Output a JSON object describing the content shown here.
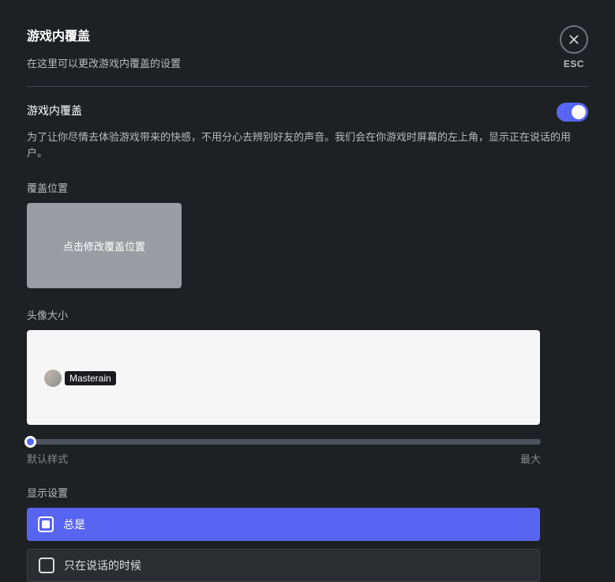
{
  "header": {
    "title": "游戏内覆盖",
    "subtitle": "在这里可以更改游戏内覆盖的设置",
    "esc_label": "ESC"
  },
  "overlay": {
    "section_title": "游戏内覆盖",
    "description": "为了让你尽情去体验游戏带来的快感，不用分心去辨别好友的声音。我们会在你游戏时屏幕的左上角，显示正在说话的用户。",
    "enabled": true
  },
  "position": {
    "label": "覆盖位置",
    "button_text": "点击修改覆盖位置"
  },
  "avatar": {
    "label": "头像大小",
    "sample_name": "Masterain"
  },
  "slider": {
    "min_label": "默认样式",
    "max_label": "最大"
  },
  "display": {
    "label": "显示设置",
    "options": [
      {
        "label": "总是",
        "selected": true
      },
      {
        "label": "只在说话的时候",
        "selected": false
      }
    ]
  }
}
